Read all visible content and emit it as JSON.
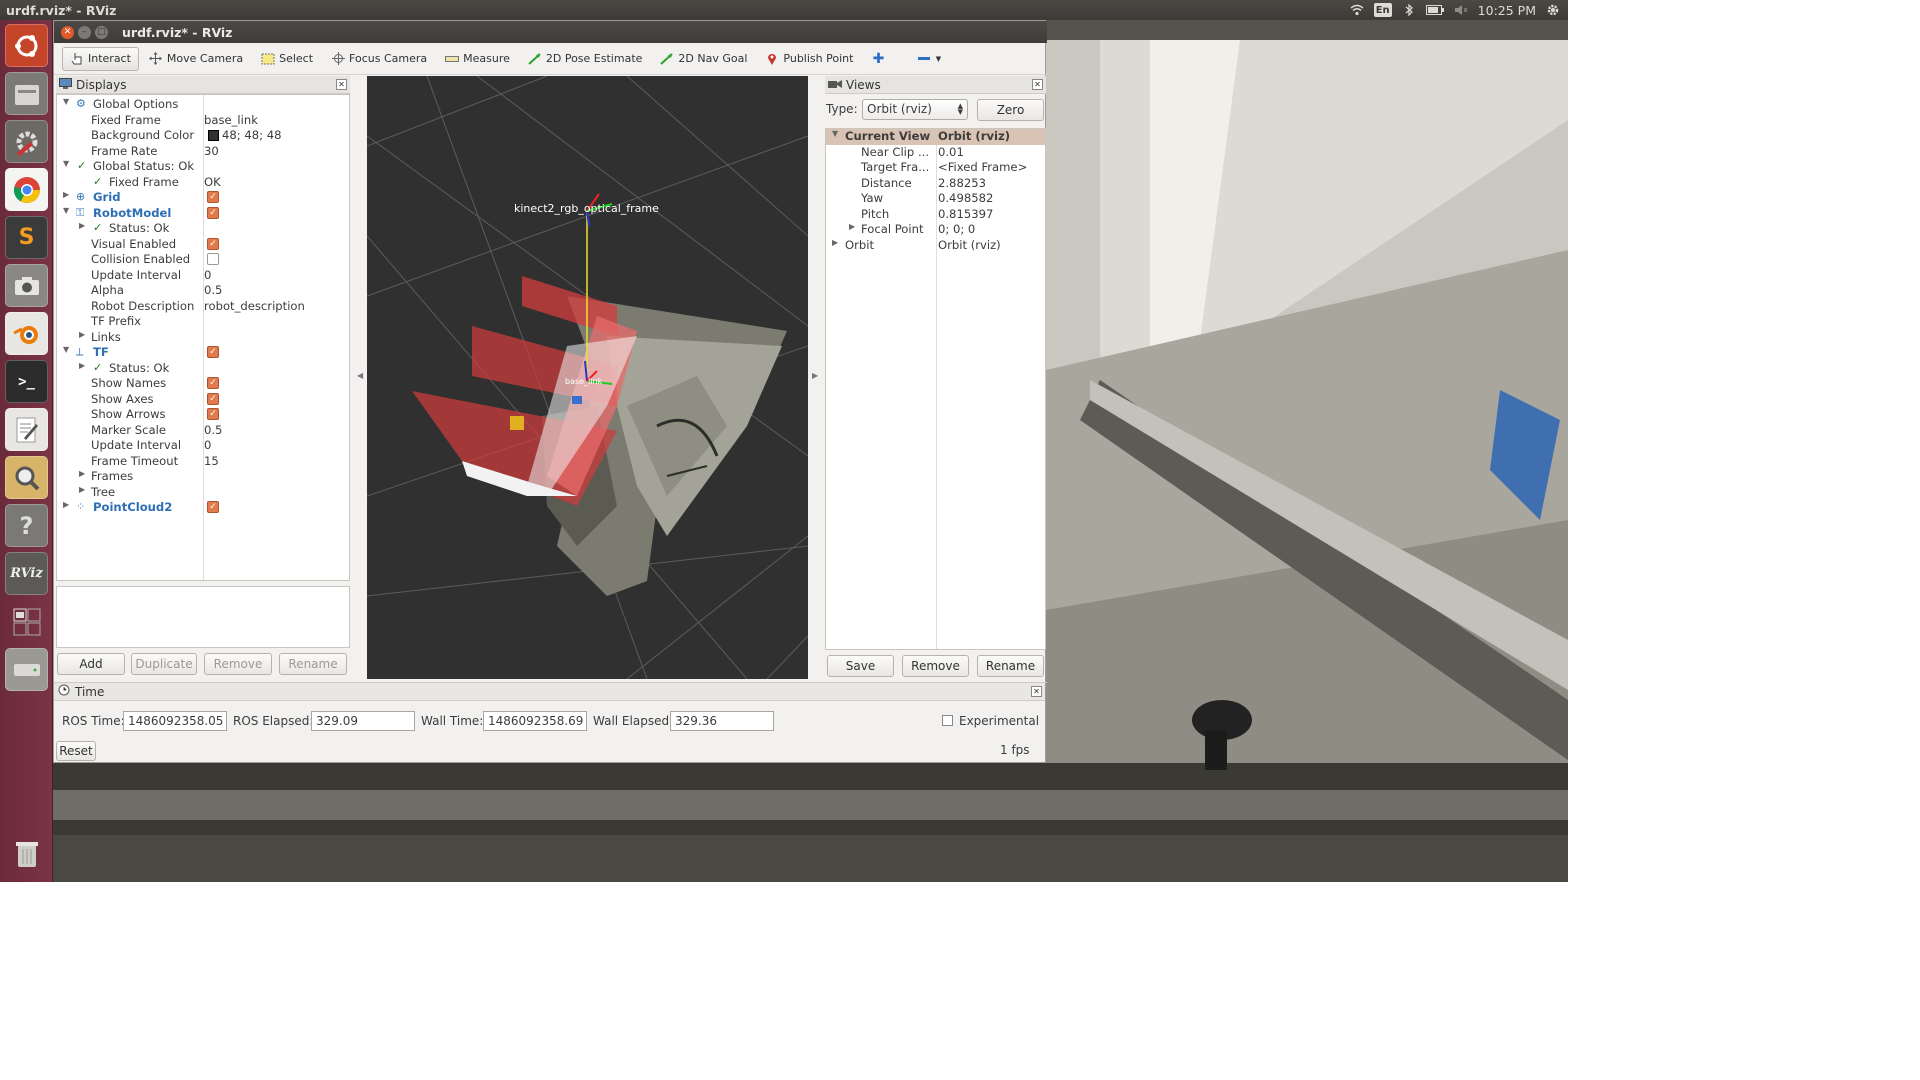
{
  "topbar": {
    "title": "urdf.rviz* - RViz",
    "lang": "En",
    "clock": "10:25 PM"
  },
  "window": {
    "title": "urdf.rviz* - RViz"
  },
  "toolbar": {
    "tools": [
      "Interact",
      "Move Camera",
      "Select",
      "Focus Camera",
      "Measure",
      "2D Pose Estimate",
      "2D Nav Goal",
      "Publish Point"
    ]
  },
  "displays": {
    "title": "Displays",
    "rows": [
      {
        "label": "Global Options",
        "value": ""
      },
      {
        "label": "Fixed Frame",
        "value": "base_link"
      },
      {
        "label": "Background Color",
        "value": "48; 48; 48"
      },
      {
        "label": "Frame Rate",
        "value": "30"
      },
      {
        "label": "Global Status: Ok",
        "value": ""
      },
      {
        "label": "Fixed Frame",
        "value": "OK"
      },
      {
        "label": "Grid",
        "value": ""
      },
      {
        "label": "RobotModel",
        "value": ""
      },
      {
        "label": "Status: Ok",
        "value": ""
      },
      {
        "label": "Visual Enabled",
        "value": ""
      },
      {
        "label": "Collision Enabled",
        "value": ""
      },
      {
        "label": "Update Interval",
        "value": "0"
      },
      {
        "label": "Alpha",
        "value": "0.5"
      },
      {
        "label": "Robot Description",
        "value": "robot_description"
      },
      {
        "label": "TF Prefix",
        "value": ""
      },
      {
        "label": "Links",
        "value": ""
      },
      {
        "label": "TF",
        "value": ""
      },
      {
        "label": "Status: Ok",
        "value": ""
      },
      {
        "label": "Show Names",
        "value": ""
      },
      {
        "label": "Show Axes",
        "value": ""
      },
      {
        "label": "Show Arrows",
        "value": ""
      },
      {
        "label": "Marker Scale",
        "value": "0.5"
      },
      {
        "label": "Update Interval",
        "value": "0"
      },
      {
        "label": "Frame Timeout",
        "value": "15"
      },
      {
        "label": "Frames",
        "value": ""
      },
      {
        "label": "Tree",
        "value": ""
      },
      {
        "label": "PointCloud2",
        "value": ""
      }
    ],
    "buttons": [
      "Add",
      "Duplicate",
      "Remove",
      "Rename"
    ]
  },
  "viewport": {
    "frame_label": "kinect2_rgb_optical_frame",
    "small_label": "base_link"
  },
  "views": {
    "title": "Views",
    "type_label": "Type:",
    "type_value": "Orbit (rviz)",
    "zero_label": "Zero",
    "rows": [
      {
        "label": "Current View",
        "value": "Orbit (rviz)"
      },
      {
        "label": "Near Clip ...",
        "value": "0.01"
      },
      {
        "label": "Target Fra...",
        "value": "<Fixed Frame>"
      },
      {
        "label": "Distance",
        "value": "2.88253"
      },
      {
        "label": "Yaw",
        "value": "0.498582"
      },
      {
        "label": "Pitch",
        "value": "0.815397"
      },
      {
        "label": "Focal Point",
        "value": "0; 0; 0"
      },
      {
        "label": "Orbit",
        "value": "Orbit (rviz)"
      }
    ],
    "buttons": [
      "Save",
      "Remove",
      "Rename"
    ]
  },
  "time": {
    "title": "Time",
    "ros_time_label": "ROS Time:",
    "ros_time": "1486092358.05",
    "ros_elapsed_label": "ROS Elapsed:",
    "ros_elapsed": "329.09",
    "wall_time_label": "Wall Time:",
    "wall_time": "1486092358.69",
    "wall_elapsed_label": "Wall Elapsed:",
    "wall_elapsed": "329.36",
    "experimental_label": "Experimental",
    "reset_label": "Reset",
    "fps": "1 fps"
  },
  "colors": {
    "launcher": "#7a3445",
    "rviz_bg": "#303030",
    "check": "#e07b4e",
    "accent_blue": "#2d6fb5"
  }
}
